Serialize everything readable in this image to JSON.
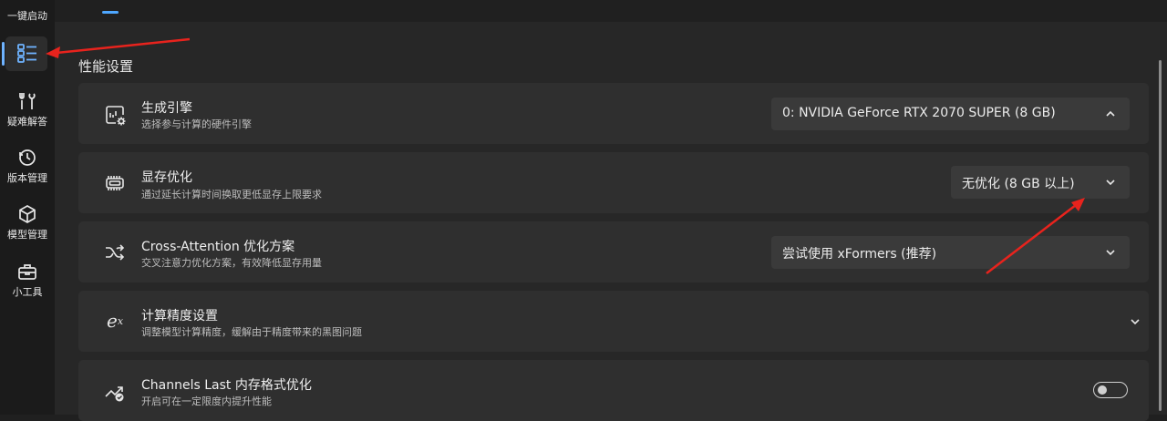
{
  "sidebar": {
    "top_label": "一键启动",
    "items": [
      {
        "label": "",
        "icon": "list-icon"
      },
      {
        "label": "疑难解答",
        "icon": "tools-icon"
      },
      {
        "label": "版本管理",
        "icon": "history-icon"
      },
      {
        "label": "模型管理",
        "icon": "cube-icon"
      },
      {
        "label": "小工具",
        "icon": "toolbox-icon"
      }
    ]
  },
  "section_title": "性能设置",
  "settings": [
    {
      "title": "生成引擎",
      "subtitle": "选择参与计算的硬件引擎",
      "control": "select",
      "value": "0: NVIDIA GeForce RTX 2070 SUPER (8 GB)",
      "icon": "engine-gear-icon"
    },
    {
      "title": "显存优化",
      "subtitle": "通过延长计算时间换取更低显存上限要求",
      "control": "select",
      "value": "无优化 (8 GB 以上)",
      "icon": "memory-chip-icon"
    },
    {
      "title": "Cross-Attention 优化方案",
      "subtitle": "交叉注意力优化方案，有效降低显存用量",
      "control": "select",
      "value": "尝试使用 xFormers (推荐)",
      "icon": "shuffle-icon"
    },
    {
      "title": "计算精度设置",
      "subtitle": "调整模型计算精度，缓解由于精度带来的黑图问题",
      "control": "expander",
      "icon": "exponent-icon"
    },
    {
      "title": "Channels Last 内存格式优化",
      "subtitle": "开启可在一定限度内提升性能",
      "control": "toggle",
      "toggle_on": false,
      "icon": "trend-check-icon"
    }
  ],
  "colors": {
    "accent": "#4ea7ff",
    "annotation_arrow": "#e8231d"
  }
}
